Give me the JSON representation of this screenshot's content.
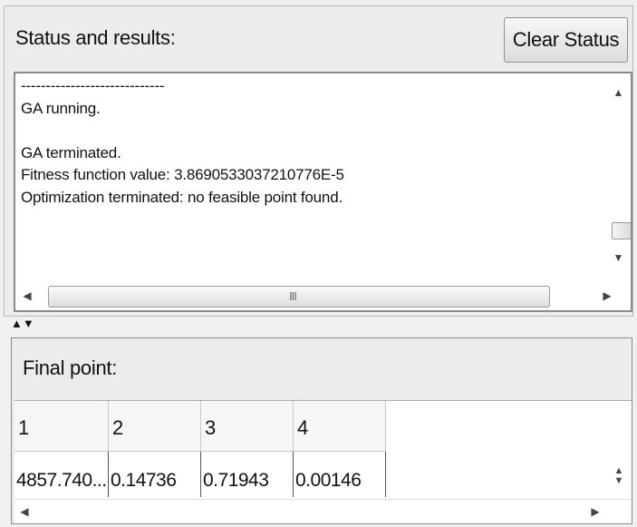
{
  "status": {
    "title": "Status and results:",
    "clear_label": "Clear Status",
    "log_text": "-----------------------------\nGA running.\n\nGA terminated.\nFitness function value: 3.8690533037210776E-5\nOptimization terminated: no feasible point found."
  },
  "icons": {
    "up": "▲",
    "down": "▼",
    "left": "◀",
    "right": "▶",
    "grip": "III"
  },
  "final": {
    "title": "Final point:",
    "headers": [
      "1",
      "2",
      "3",
      "4"
    ],
    "values": [
      "4857.740...",
      "0.14736",
      "0.71943",
      "0.00146"
    ]
  }
}
